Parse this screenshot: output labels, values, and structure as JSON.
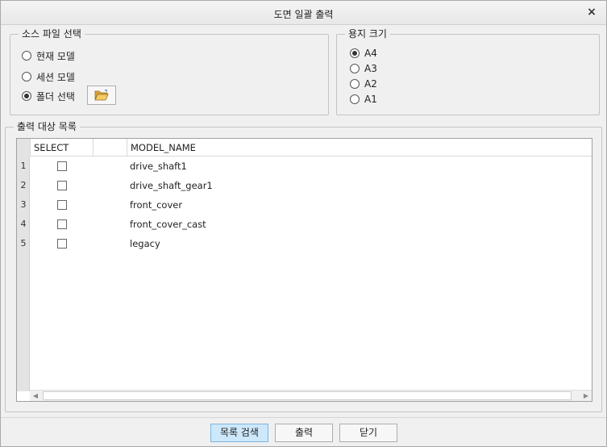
{
  "window": {
    "title": "도면 일괄 출력",
    "close_glyph": "×"
  },
  "source": {
    "legend": "소스 파일 선택",
    "options": [
      {
        "label": "현재 모델",
        "checked": false
      },
      {
        "label": "세션 모델",
        "checked": false
      },
      {
        "label": "폴더 선택",
        "checked": true
      }
    ],
    "folder_icon": "folder-open-icon"
  },
  "paper": {
    "legend": "용지 크기",
    "options": [
      {
        "label": "A4",
        "checked": true
      },
      {
        "label": "A3",
        "checked": false
      },
      {
        "label": "A2",
        "checked": false
      },
      {
        "label": "A1",
        "checked": false
      }
    ]
  },
  "list": {
    "legend": "출력 대상 목록",
    "columns": [
      "SELECT",
      "",
      "MODEL_NAME"
    ],
    "rows": [
      {
        "num": "1",
        "selected": false,
        "model_name": "drive_shaft1"
      },
      {
        "num": "2",
        "selected": false,
        "model_name": "drive_shaft_gear1"
      },
      {
        "num": "3",
        "selected": false,
        "model_name": "front_cover"
      },
      {
        "num": "4",
        "selected": false,
        "model_name": "front_cover_cast"
      },
      {
        "num": "5",
        "selected": false,
        "model_name": "legacy"
      }
    ]
  },
  "buttons": {
    "search": "목록 검색",
    "print": "출력",
    "close": "닫기"
  },
  "colors": {
    "primary_button_bg": "#cde8fb",
    "primary_button_border": "#7ab4e0",
    "folder_icon": "#e8b84a"
  }
}
